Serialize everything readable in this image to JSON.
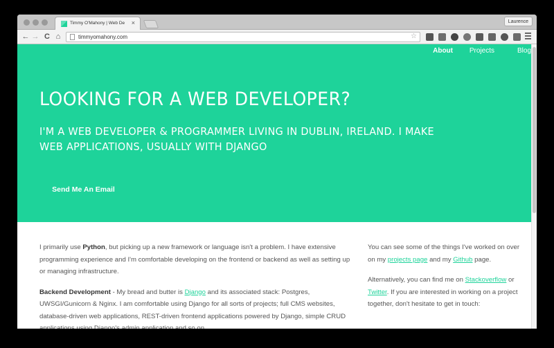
{
  "browser": {
    "tab_title": "Timmy O'Mahony | Web De",
    "tab_close": "×",
    "profile_name": "Laurence",
    "url": "timmyomahony.com",
    "back": "←",
    "forward": "→",
    "reload": "C",
    "home": "⌂",
    "star": "☆"
  },
  "nav": {
    "items": [
      "About",
      "Projects",
      "Blog"
    ]
  },
  "hero": {
    "title": "LOOKING FOR A WEB DEVELOPER?",
    "subtitle": "I'M A WEB DEVELOPER & PROGRAMMER LIVING IN DUBLIN, IRELAND. I MAKE WEB APPLICATIONS, USUALLY WITH DJANGO",
    "cta": "Send Me An Email"
  },
  "main": {
    "p1_a": "I primarily use ",
    "p1_b": "Python",
    "p1_c": ", but picking up a new framework or language isn't a problem. I have extensive programming experience and I'm comfortable developing on the frontend or backend as well as setting up or managing infrastructure.",
    "p2_a": "Backend Development",
    "p2_b": " - My bread and butter is ",
    "p2_link": "Django",
    "p2_c": " and its associated stack: Postgres, UWSGI/Gunicorn & Nginx. I am comfortable using Django for all sorts of projects; full CMS websites, database-driven web applications, REST-driven frontend applications powered by Django, simple CRUD applications using Django's admin application and so on."
  },
  "side": {
    "p1_a": "You can see some of the things I've worked on over on my ",
    "p1_link1": "projects page",
    "p1_b": " and my ",
    "p1_link2": "Github",
    "p1_c": " page.",
    "p2_a": "Alternatively, you can find me on ",
    "p2_link1": "Stackoverflow",
    "p2_b": " or ",
    "p2_link2": "Twitter",
    "p2_c": ". If you are interested in working on a project together, don't hesitate to get in touch:"
  },
  "colors": {
    "accent": "#1ed39a"
  }
}
